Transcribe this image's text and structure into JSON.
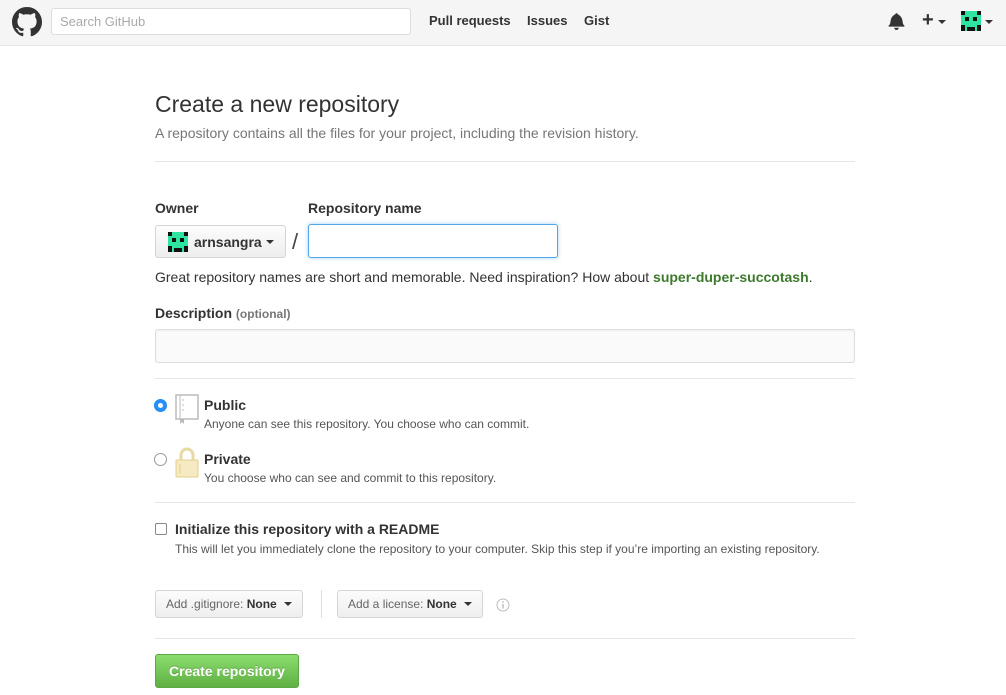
{
  "header": {
    "search_placeholder": "Search GitHub",
    "nav": [
      "Pull requests",
      "Issues",
      "Gist"
    ],
    "new_label": "+",
    "icons": [
      "github-logo-icon",
      "bell-icon",
      "plus-icon",
      "avatar-icon"
    ]
  },
  "page": {
    "title": "Create a new repository",
    "subtitle": "A repository contains all the files for your project, including the revision history."
  },
  "form": {
    "owner_label": "Owner",
    "owner_value": "arnsangra",
    "separator": "/",
    "repo_name_label": "Repository name",
    "repo_name_value": "",
    "hint_text": "Great repository names are short and memorable. Need inspiration? How about ",
    "hint_suggestion": "super-duper-succotash",
    "hint_end": ".",
    "description_label": "Description",
    "description_optional": "(optional)",
    "description_value": ""
  },
  "visibility": {
    "public_title": "Public",
    "public_desc": "Anyone can see this repository. You choose who can commit.",
    "private_title": "Private",
    "private_desc": "You choose who can see and commit to this repository.",
    "selected": "public"
  },
  "init": {
    "readme_title": "Initialize this repository with a README",
    "readme_desc": "This will let you immediately clone the repository to your computer. Skip this step if you’re importing an existing repository.",
    "readme_checked": false,
    "gitignore_label": "Add .gitignore:",
    "gitignore_value": "None",
    "license_label": "Add a license:",
    "license_value": "None"
  },
  "submit_label": "Create repository",
  "colors": {
    "accent_blue": "#2a8ff7",
    "suggestion_green": "#3d7a2c",
    "button_green": "#60b044",
    "avatar_green": "#2fe3a0"
  }
}
